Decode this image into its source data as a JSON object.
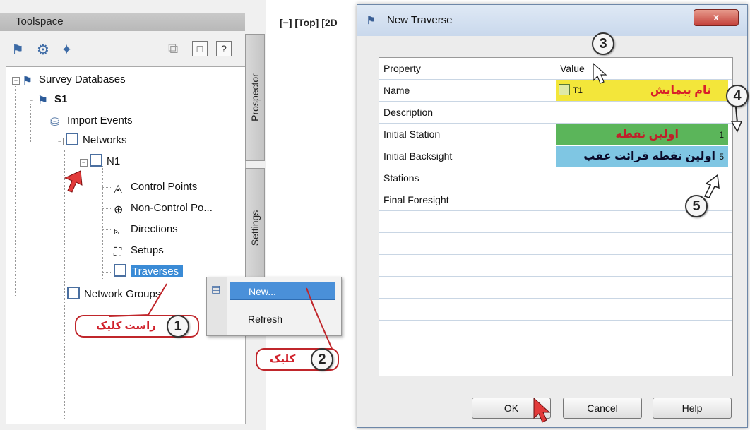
{
  "toolspace": {
    "title": "Toolspace",
    "help_button": "?",
    "side_tabs": [
      "Prospector",
      "Settings"
    ],
    "tree": {
      "root": "Survey Databases",
      "database": "S1",
      "import_events": "Import Events",
      "networks": "Networks",
      "network": "N1",
      "children": [
        "Control Points",
        "Non-Control Po...",
        "Directions",
        "Setups",
        "Traverses"
      ],
      "network_groups": "Network Groups"
    }
  },
  "viewport": {
    "label": "[−] [Top] [2D"
  },
  "context_menu": {
    "items": [
      "New...",
      "Refresh"
    ]
  },
  "callouts": {
    "step1": {
      "number": "1",
      "text": "راست کلیک"
    },
    "step2": {
      "number": "2",
      "text": "کلیک"
    },
    "step3": {
      "number": "3"
    },
    "step4": {
      "number": "4"
    },
    "step5": {
      "number": "5"
    }
  },
  "dialog": {
    "title": "New Traverse",
    "close": "x",
    "columns": [
      "Property",
      "Value"
    ],
    "rows": [
      {
        "property": "Name",
        "value": "T1",
        "annotation": "نام پیمایش"
      },
      {
        "property": "Description",
        "value": ""
      },
      {
        "property": "Initial Station",
        "value": "1",
        "annotation": "اولین نقطه"
      },
      {
        "property": "Initial Backsight",
        "value": "5",
        "annotation": "اولین نقطه قرائت عقب"
      },
      {
        "property": "Stations",
        "value": ""
      },
      {
        "property": "Final Foresight",
        "value": ""
      }
    ],
    "buttons": {
      "ok": "OK",
      "cancel": "Cancel",
      "help": "Help"
    }
  },
  "colors": {
    "name_band": "#f3e63a",
    "station_band": "#5bb55a",
    "backsight_band": "#7fc6e3",
    "annotation_red": "#d8202a",
    "selection": "#3a8bd6"
  }
}
